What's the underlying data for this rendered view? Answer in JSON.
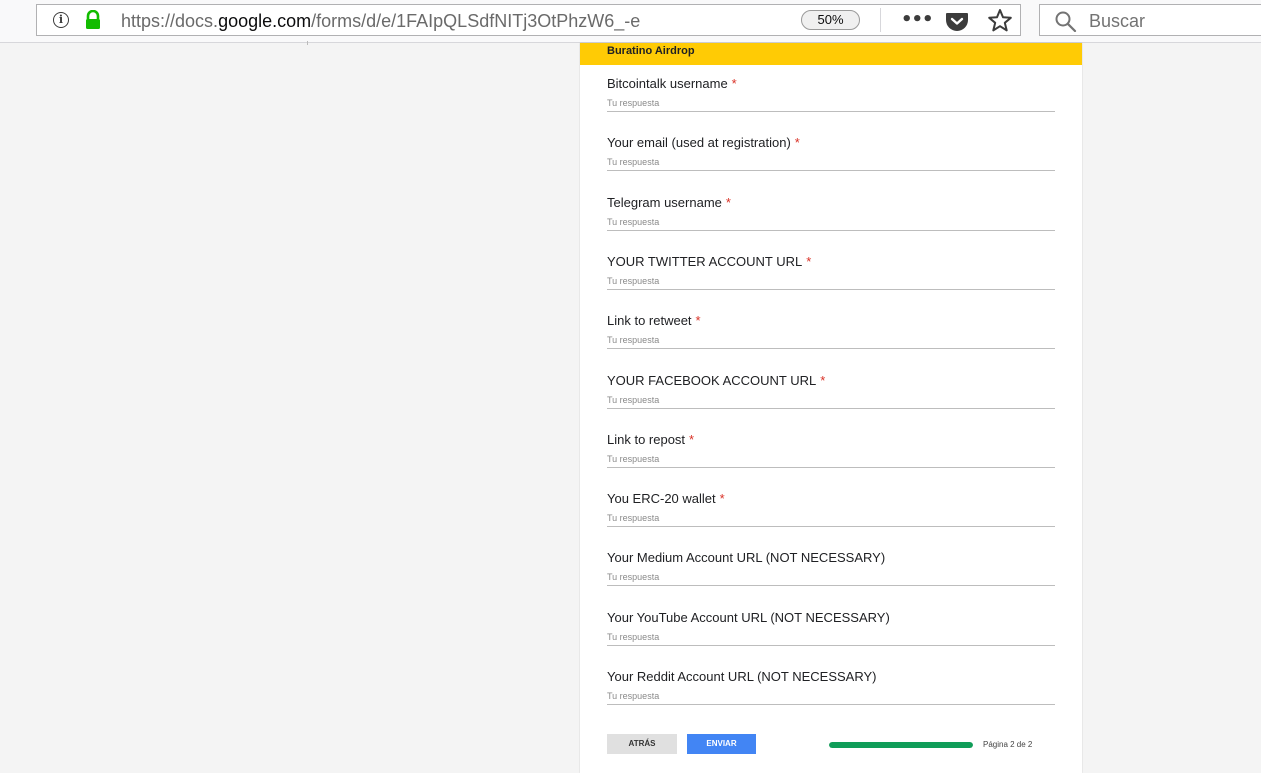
{
  "browser": {
    "url_prefix": "https://docs.",
    "url_domain": "google.com",
    "url_path": "/forms/d/e/1FAIpQLSdfNITj3OtPhzW6_-e",
    "zoom": "50%",
    "search_placeholder": "Buscar",
    "icons": {
      "info": "info-icon",
      "lock": "lock-icon",
      "more": "more-icon",
      "pocket": "pocket-icon",
      "bookmark": "star-icon",
      "search": "search-icon"
    }
  },
  "form": {
    "title": "Buratino Airdrop",
    "accent_color": "#ffcb05",
    "required_marker": "*",
    "placeholder": "Tu respuesta",
    "questions": [
      {
        "label": "Bitcointalk username",
        "required": true
      },
      {
        "label": "Your email (used at registration)",
        "required": true
      },
      {
        "label": "Telegram username",
        "required": true
      },
      {
        "label": "YOUR TWITTER ACCOUNT URL",
        "required": true
      },
      {
        "label": "Link to retweet",
        "required": true
      },
      {
        "label": "YOUR FACEBOOK ACCOUNT URL",
        "required": true
      },
      {
        "label": "Link to repost",
        "required": true
      },
      {
        "label": "You ERC-20 wallet",
        "required": true
      },
      {
        "label": "Your Medium Account URL (NOT NECESSARY)",
        "required": false
      },
      {
        "label": "Your YouTube Account URL (NOT NECESSARY)",
        "required": false
      },
      {
        "label": "Your Reddit Account URL (NOT NECESSARY)",
        "required": false
      }
    ],
    "back_label": "ATRÁS",
    "submit_label": "ENVIAR",
    "submit_color": "#4285f4",
    "progress_fraction": 1.0,
    "progress_color": "#0f9d58",
    "page_indicator": "Página 2 de 2"
  }
}
